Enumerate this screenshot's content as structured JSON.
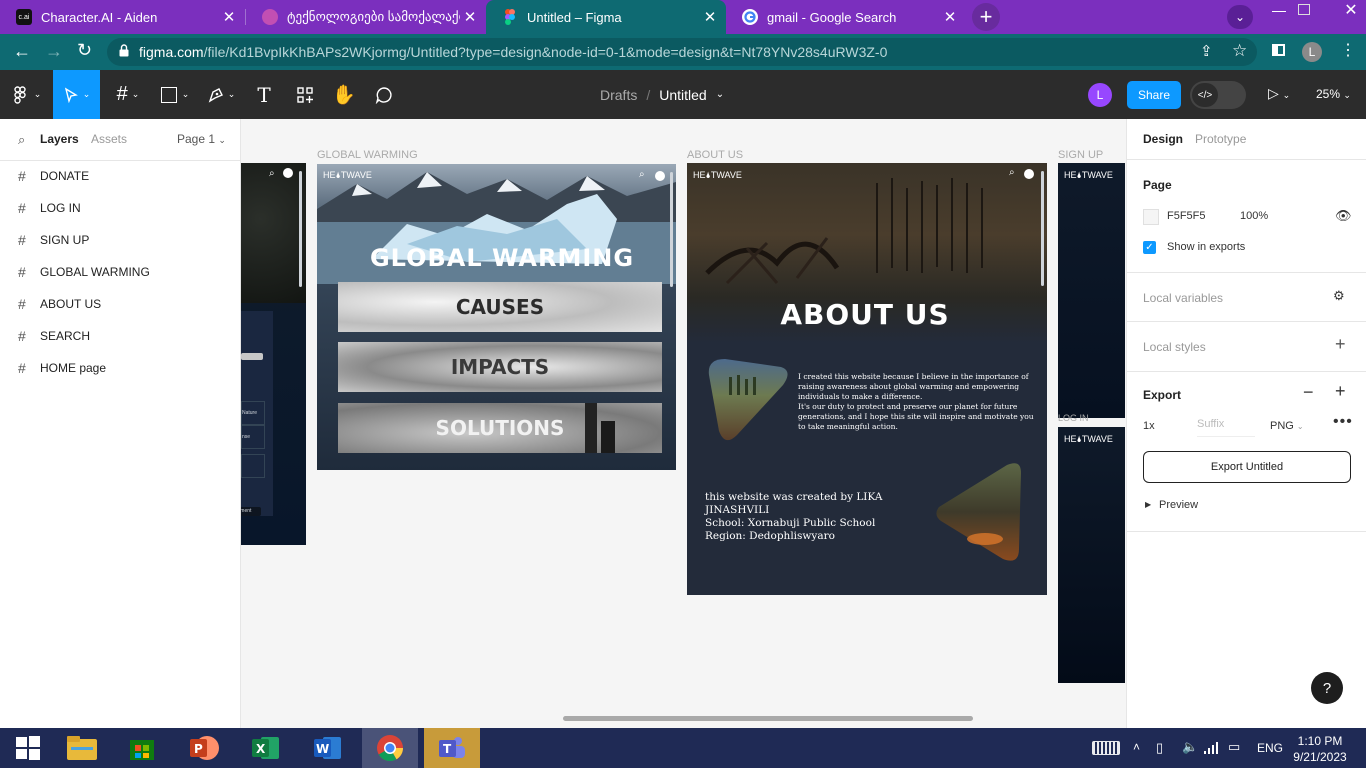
{
  "browser": {
    "tabs": [
      {
        "title": "Character.AI - Aiden",
        "icon": "characterai-icon",
        "fav_text": "c.ai",
        "active": false
      },
      {
        "title": "ტექნოლოგიები სამოქალაქო",
        "icon": "tech-site-icon",
        "active": false
      },
      {
        "title": "Untitled – Figma",
        "icon": "figma-icon",
        "active": true
      },
      {
        "title": "gmail - Google Search",
        "icon": "google-icon",
        "active": false
      }
    ],
    "new_tab_label": "+",
    "url_host": "figma.com",
    "url_rest": "/file/Kd1BvpIkKhBAPs2WKjormg/Untitled?type=design&node-id=0-1&mode=design&t=Nt78YNv28s4uRW3Z-0",
    "profile_initial": "L",
    "accent": "#7b2fbe",
    "toolbar_color": "#0e6a72"
  },
  "figma": {
    "breadcrumb_drafts": "Drafts",
    "breadcrumb_sep": "/",
    "file_name": "Untitled",
    "user_initial": "L",
    "share_label": "Share",
    "zoom": "25%",
    "share_color": "#0d99ff",
    "user_color": "#9747ff",
    "left_tabs": {
      "layers": "Layers",
      "assets": "Assets",
      "page": "Page 1"
    },
    "layers": [
      "DONATE",
      "LOG IN",
      "SIGN UP",
      "GLOBAL WARMING",
      "ABOUT US",
      "SEARCH",
      "HOME page"
    ],
    "right_tabs": {
      "design": "Design",
      "prototype": "Prototype"
    },
    "page_section": {
      "title": "Page",
      "color_hex": "F5F5F5",
      "opacity": "100%",
      "show_in_exports": "Show in exports"
    },
    "local_variables": "Local variables",
    "local_styles": "Local styles",
    "export": {
      "title": "Export",
      "scale": "1x",
      "suffix_placeholder": "Suffix",
      "format": "PNG",
      "button": "Export Untitled",
      "preview": "Preview"
    },
    "help_label": "?"
  },
  "canvas": {
    "frame_labels": {
      "global_warming": "GLOBAL WARMING",
      "about_us": "ABOUT US",
      "sign_up": "SIGN UP",
      "log_in": "LOG IN"
    },
    "brand": "HE🌢TWAVE",
    "left_frame_texts": [
      "Nature",
      "nse",
      "ayment"
    ],
    "global_warming": {
      "heading": "GLOBAL WARMING",
      "buttons": [
        "CAUSES",
        "IMPACTS",
        "SOLUTIONS"
      ]
    },
    "about_us": {
      "heading": "ABOUT US",
      "paragraph": "I created this website because I believe in the importance of raising awareness about global warming and empowering individuals to make a difference.",
      "paragraph2": "It's our duty to protect and preserve our planet for future generations, and I hope this site will inspire and motivate you to take meaningful action.",
      "credit_line1": "this website was created by LIKA JINASHVILI",
      "credit_line2": "School: Xornabuji Public School",
      "credit_line3": "Region: Dedophliswyaro"
    }
  },
  "taskbar": {
    "apps": [
      "file-explorer-icon",
      "microsoft-store-icon",
      "powerpoint-icon",
      "excel-icon",
      "word-icon",
      "chrome-icon",
      "teams-icon"
    ],
    "language": "ENG",
    "time": "1:10 PM",
    "date": "9/21/2023"
  }
}
